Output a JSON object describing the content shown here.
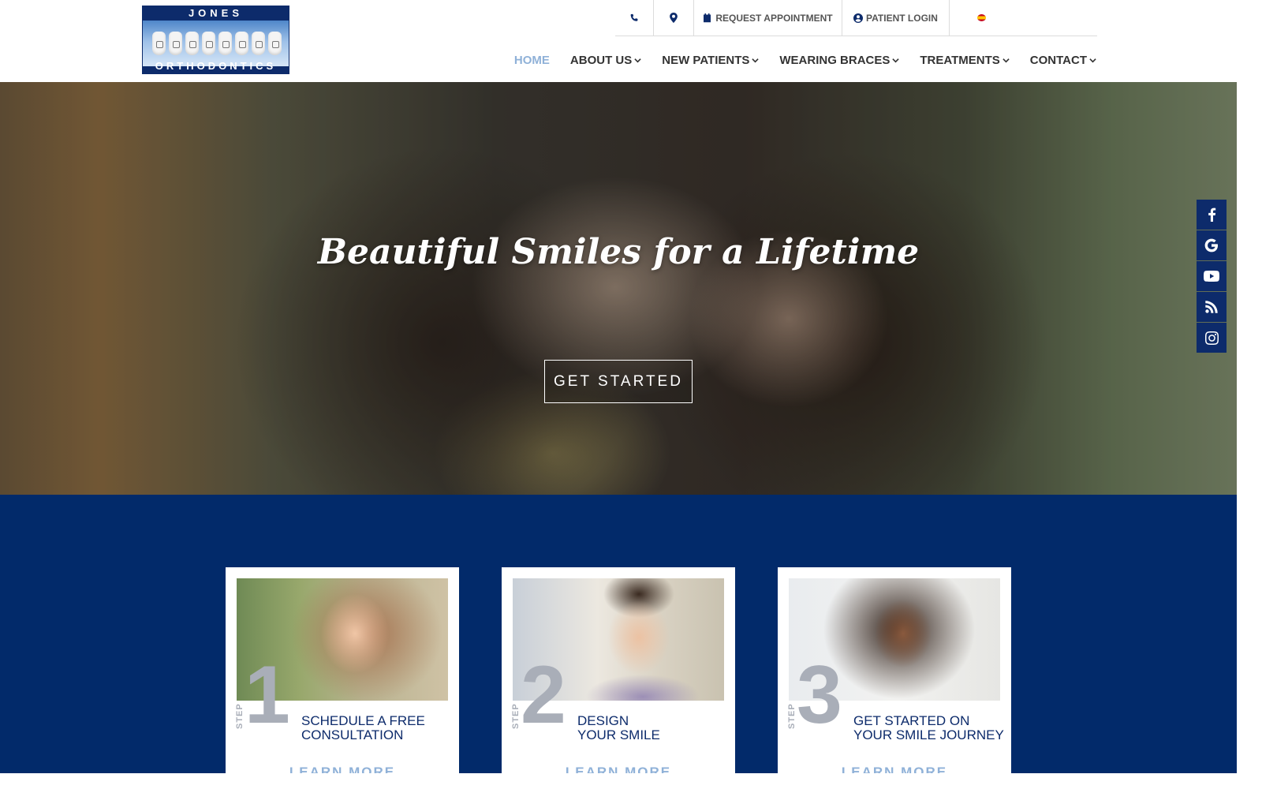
{
  "logo": {
    "top": "JONES",
    "bottom": "ORTHODONTICS"
  },
  "utility": {
    "phone_icon": "phone-icon",
    "map_icon": "map-marker-icon",
    "appointment_label": "REQUEST APPOINTMENT",
    "login_label": "PATIENT LOGIN",
    "language_icon": "spain-flag-icon"
  },
  "nav": {
    "items": [
      {
        "label": "HOME",
        "active": true
      },
      {
        "label": "ABOUT US",
        "dropdown": true
      },
      {
        "label": "NEW PATIENTS",
        "dropdown": true
      },
      {
        "label": "WEARING BRACES",
        "dropdown": true
      },
      {
        "label": "TREATMENTS",
        "dropdown": true
      },
      {
        "label": "CONTACT",
        "dropdown": true
      }
    ]
  },
  "hero": {
    "title": "Beautiful Smiles for a Lifetime",
    "button": "GET STARTED"
  },
  "social": [
    "facebook-icon",
    "google-icon",
    "youtube-icon",
    "rss-icon",
    "instagram-icon"
  ],
  "steps": [
    {
      "word": "STEP",
      "number": "1",
      "line1": "SCHEDULE A FREE",
      "line2": "CONSULTATION",
      "link": "LEARN MORE"
    },
    {
      "word": "STEP",
      "number": "2",
      "line1": "DESIGN",
      "line2": "YOUR SMILE",
      "link": "LEARN MORE"
    },
    {
      "word": "STEP",
      "number": "3",
      "line1": "GET STARTED ON",
      "line2": "YOUR SMILE JOURNEY",
      "link": "LEARN MORE"
    }
  ],
  "colors": {
    "navy": "#022a6a",
    "accent": "#8fb1d8",
    "step_gray": "#a9aeb8"
  }
}
